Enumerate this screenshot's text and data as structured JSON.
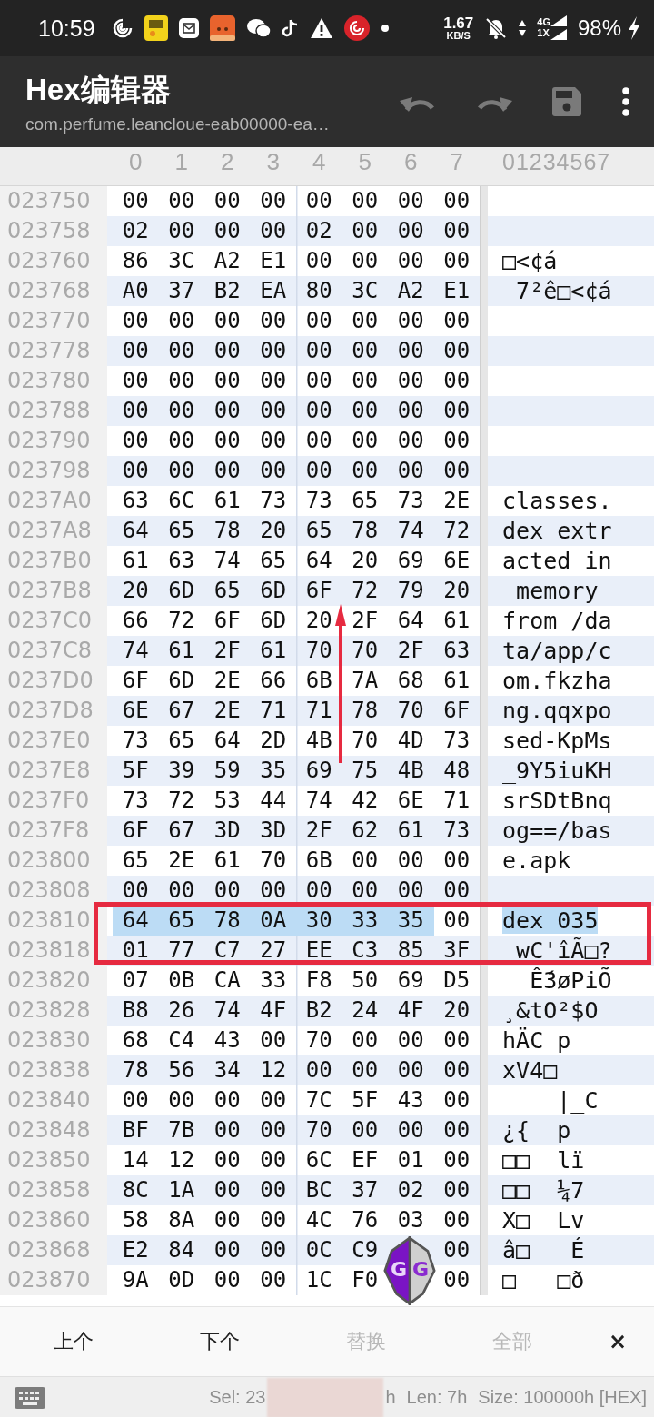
{
  "status_bar": {
    "time": "10:59",
    "net_speed": "1.67",
    "net_unit": "KB/S",
    "network": "4G",
    "network_sub": "1X",
    "battery": "98%"
  },
  "app_bar": {
    "title": "Hex编辑器",
    "subtitle": "com.perfume.leancloue-eab00000-ea…"
  },
  "hex_view": {
    "columns": [
      "0",
      "1",
      "2",
      "3",
      "4",
      "5",
      "6",
      "7"
    ],
    "ascii_header": "01234567",
    "rows": [
      {
        "address": "023750",
        "hex": [
          "00",
          "00",
          "00",
          "00",
          "00",
          "00",
          "00",
          "00"
        ],
        "selected": [
          false,
          false,
          false,
          false,
          false,
          false,
          false,
          false
        ]
      },
      {
        "address": "023758",
        "hex": [
          "02",
          "00",
          "00",
          "00",
          "02",
          "00",
          "00",
          "00"
        ],
        "selected": [
          false,
          false,
          false,
          false,
          false,
          false,
          false,
          false
        ]
      },
      {
        "address": "023760",
        "hex": [
          "86",
          "3C",
          "A2",
          "E1",
          "00",
          "00",
          "00",
          "00"
        ],
        "ascii": "□<¢á",
        "selected": [
          false,
          false,
          false,
          false,
          false,
          false,
          false,
          false
        ]
      },
      {
        "address": "023768",
        "hex": [
          "A0",
          "37",
          "B2",
          "EA",
          "80",
          "3C",
          "A2",
          "E1"
        ],
        "ascii": " 7²ê□<¢á",
        "selected": [
          false,
          false,
          false,
          false,
          false,
          false,
          false,
          false
        ]
      },
      {
        "address": "023770",
        "hex": [
          "00",
          "00",
          "00",
          "00",
          "00",
          "00",
          "00",
          "00"
        ],
        "selected": [
          false,
          false,
          false,
          false,
          false,
          false,
          false,
          false
        ]
      },
      {
        "address": "023778",
        "hex": [
          "00",
          "00",
          "00",
          "00",
          "00",
          "00",
          "00",
          "00"
        ],
        "selected": [
          false,
          false,
          false,
          false,
          false,
          false,
          false,
          false
        ]
      },
      {
        "address": "023780",
        "hex": [
          "00",
          "00",
          "00",
          "00",
          "00",
          "00",
          "00",
          "00"
        ],
        "selected": [
          false,
          false,
          false,
          false,
          false,
          false,
          false,
          false
        ]
      },
      {
        "address": "023788",
        "hex": [
          "00",
          "00",
          "00",
          "00",
          "00",
          "00",
          "00",
          "00"
        ],
        "selected": [
          false,
          false,
          false,
          false,
          false,
          false,
          false,
          false
        ]
      },
      {
        "address": "023790",
        "hex": [
          "00",
          "00",
          "00",
          "00",
          "00",
          "00",
          "00",
          "00"
        ],
        "selected": [
          false,
          false,
          false,
          false,
          false,
          false,
          false,
          false
        ]
      },
      {
        "address": "023798",
        "hex": [
          "00",
          "00",
          "00",
          "00",
          "00",
          "00",
          "00",
          "00"
        ],
        "selected": [
          false,
          false,
          false,
          false,
          false,
          false,
          false,
          false
        ]
      },
      {
        "address": "0237A0",
        "hex": [
          "63",
          "6C",
          "61",
          "73",
          "73",
          "65",
          "73",
          "2E"
        ],
        "ascii": "classes.",
        "selected": [
          false,
          false,
          false,
          false,
          false,
          false,
          false,
          false
        ]
      },
      {
        "address": "0237A8",
        "hex": [
          "64",
          "65",
          "78",
          "20",
          "65",
          "78",
          "74",
          "72"
        ],
        "ascii": "dex extr",
        "selected": [
          false,
          false,
          false,
          false,
          false,
          false,
          false,
          false
        ]
      },
      {
        "address": "0237B0",
        "hex": [
          "61",
          "63",
          "74",
          "65",
          "64",
          "20",
          "69",
          "6E"
        ],
        "ascii": "acted in",
        "selected": [
          false,
          false,
          false,
          false,
          false,
          false,
          false,
          false
        ]
      },
      {
        "address": "0237B8",
        "hex": [
          "20",
          "6D",
          "65",
          "6D",
          "6F",
          "72",
          "79",
          "20"
        ],
        "ascii": " memory",
        "selected": [
          false,
          false,
          false,
          false,
          false,
          false,
          false,
          false
        ]
      },
      {
        "address": "0237C0",
        "hex": [
          "66",
          "72",
          "6F",
          "6D",
          "20",
          "2F",
          "64",
          "61"
        ],
        "ascii": "from /da",
        "selected": [
          false,
          false,
          false,
          false,
          false,
          false,
          false,
          false
        ]
      },
      {
        "address": "0237C8",
        "hex": [
          "74",
          "61",
          "2F",
          "61",
          "70",
          "70",
          "2F",
          "63"
        ],
        "ascii": "ta/app/c",
        "selected": [
          false,
          false,
          false,
          false,
          false,
          false,
          false,
          false
        ]
      },
      {
        "address": "0237D0",
        "hex": [
          "6F",
          "6D",
          "2E",
          "66",
          "6B",
          "7A",
          "68",
          "61"
        ],
        "ascii": "om.fkzha",
        "selected": [
          false,
          false,
          false,
          false,
          false,
          false,
          false,
          false
        ]
      },
      {
        "address": "0237D8",
        "hex": [
          "6E",
          "67",
          "2E",
          "71",
          "71",
          "78",
          "70",
          "6F"
        ],
        "ascii": "ng.qqxpo",
        "selected": [
          false,
          false,
          false,
          false,
          false,
          false,
          false,
          false
        ]
      },
      {
        "address": "0237E0",
        "hex": [
          "73",
          "65",
          "64",
          "2D",
          "4B",
          "70",
          "4D",
          "73"
        ],
        "ascii": "sed-KpMs",
        "selected": [
          false,
          false,
          false,
          false,
          false,
          false,
          false,
          false
        ]
      },
      {
        "address": "0237E8",
        "hex": [
          "5F",
          "39",
          "59",
          "35",
          "69",
          "75",
          "4B",
          "48"
        ],
        "ascii": "_9Y5iuKH",
        "selected": [
          false,
          false,
          false,
          false,
          false,
          false,
          false,
          false
        ]
      },
      {
        "address": "0237F0",
        "hex": [
          "73",
          "72",
          "53",
          "44",
          "74",
          "42",
          "6E",
          "71"
        ],
        "ascii": "srSDtBnq",
        "selected": [
          false,
          false,
          false,
          false,
          false,
          false,
          false,
          false
        ]
      },
      {
        "address": "0237F8",
        "hex": [
          "6F",
          "67",
          "3D",
          "3D",
          "2F",
          "62",
          "61",
          "73"
        ],
        "ascii": "og==/bas",
        "selected": [
          false,
          false,
          false,
          false,
          false,
          false,
          false,
          false
        ]
      },
      {
        "address": "023800",
        "hex": [
          "65",
          "2E",
          "61",
          "70",
          "6B",
          "00",
          "00",
          "00"
        ],
        "ascii": "e.apk",
        "selected": [
          false,
          false,
          false,
          false,
          false,
          false,
          false,
          false
        ]
      },
      {
        "address": "023808",
        "hex": [
          "00",
          "00",
          "00",
          "00",
          "00",
          "00",
          "00",
          "00"
        ],
        "selected": [
          false,
          false,
          false,
          false,
          false,
          false,
          false,
          false
        ]
      },
      {
        "address": "023810",
        "hex": [
          "64",
          "65",
          "78",
          "0A",
          "30",
          "33",
          "35",
          "00"
        ],
        "ascii": "dex 035",
        "selected": [
          true,
          true,
          true,
          true,
          true,
          true,
          true,
          false
        ]
      },
      {
        "address": "023818",
        "hex": [
          "01",
          "77",
          "C7",
          "27",
          "EE",
          "C3",
          "85",
          "3F"
        ],
        "ascii": " wC'îÃ□?",
        "selected": [
          false,
          false,
          false,
          false,
          false,
          false,
          false,
          false
        ]
      },
      {
        "address": "023820",
        "hex": [
          "07",
          "0B",
          "CA",
          "33",
          "F8",
          "50",
          "69",
          "D5"
        ],
        "ascii": "  Ế3øPiÕ",
        "selected": [
          false,
          false,
          false,
          false,
          false,
          false,
          false,
          false
        ]
      },
      {
        "address": "023828",
        "hex": [
          "B8",
          "26",
          "74",
          "4F",
          "B2",
          "24",
          "4F",
          "20"
        ],
        "ascii": "¸&tO²$O",
        "selected": [
          false,
          false,
          false,
          false,
          false,
          false,
          false,
          false
        ]
      },
      {
        "address": "023830",
        "hex": [
          "68",
          "C4",
          "43",
          "00",
          "70",
          "00",
          "00",
          "00"
        ],
        "ascii": "hÄC p",
        "selected": [
          false,
          false,
          false,
          false,
          false,
          false,
          false,
          false
        ]
      },
      {
        "address": "023838",
        "hex": [
          "78",
          "56",
          "34",
          "12",
          "00",
          "00",
          "00",
          "00"
        ],
        "ascii": "xV4□",
        "selected": [
          false,
          false,
          false,
          false,
          false,
          false,
          false,
          false
        ]
      },
      {
        "address": "023840",
        "hex": [
          "00",
          "00",
          "00",
          "00",
          "7C",
          "5F",
          "43",
          "00"
        ],
        "ascii": "    |_C",
        "selected": [
          false,
          false,
          false,
          false,
          false,
          false,
          false,
          false
        ]
      },
      {
        "address": "023848",
        "hex": [
          "BF",
          "7B",
          "00",
          "00",
          "70",
          "00",
          "00",
          "00"
        ],
        "ascii": "¿{  p",
        "selected": [
          false,
          false,
          false,
          false,
          false,
          false,
          false,
          false
        ]
      },
      {
        "address": "023850",
        "hex": [
          "14",
          "12",
          "00",
          "00",
          "6C",
          "EF",
          "01",
          "00"
        ],
        "ascii": "□□  lï",
        "selected": [
          false,
          false,
          false,
          false,
          false,
          false,
          false,
          false
        ]
      },
      {
        "address": "023858",
        "hex": [
          "8C",
          "1A",
          "00",
          "00",
          "BC",
          "37",
          "02",
          "00"
        ],
        "ascii": "□□  ¼7",
        "selected": [
          false,
          false,
          false,
          false,
          false,
          false,
          false,
          false
        ]
      },
      {
        "address": "023860",
        "hex": [
          "58",
          "8A",
          "00",
          "00",
          "4C",
          "76",
          "03",
          "00"
        ],
        "ascii": "X□  Lv",
        "selected": [
          false,
          false,
          false,
          false,
          false,
          false,
          false,
          false
        ]
      },
      {
        "address": "023868",
        "hex": [
          "E2",
          "84",
          "00",
          "00",
          "0C",
          "C9",
          "00"
        ],
        "covered_cell": true,
        "ascii": "â□   É",
        "selected": [
          false,
          false,
          false,
          false,
          false,
          false,
          false
        ]
      },
      {
        "address": "023870",
        "hex": [
          "9A",
          "0D",
          "00",
          "00",
          "1C",
          "F0",
          "00"
        ],
        "covered_cell": true,
        "ascii": "□   □ð",
        "selected": [
          false,
          false,
          false,
          false,
          false,
          false,
          false
        ]
      }
    ]
  },
  "floating_badge": {
    "letters": [
      "G",
      "G"
    ]
  },
  "find_bar": {
    "buttons": [
      {
        "label": "上个",
        "disabled": false
      },
      {
        "label": "下个",
        "disabled": false
      },
      {
        "label": "替换",
        "disabled": true
      },
      {
        "label": "全部",
        "disabled": true
      }
    ],
    "close": "×"
  },
  "info_bar": {
    "selection_start": "Sel: 23",
    "selection_end": "h",
    "length": "Len: 7h",
    "size": "Size: 100000h [HEX]"
  }
}
